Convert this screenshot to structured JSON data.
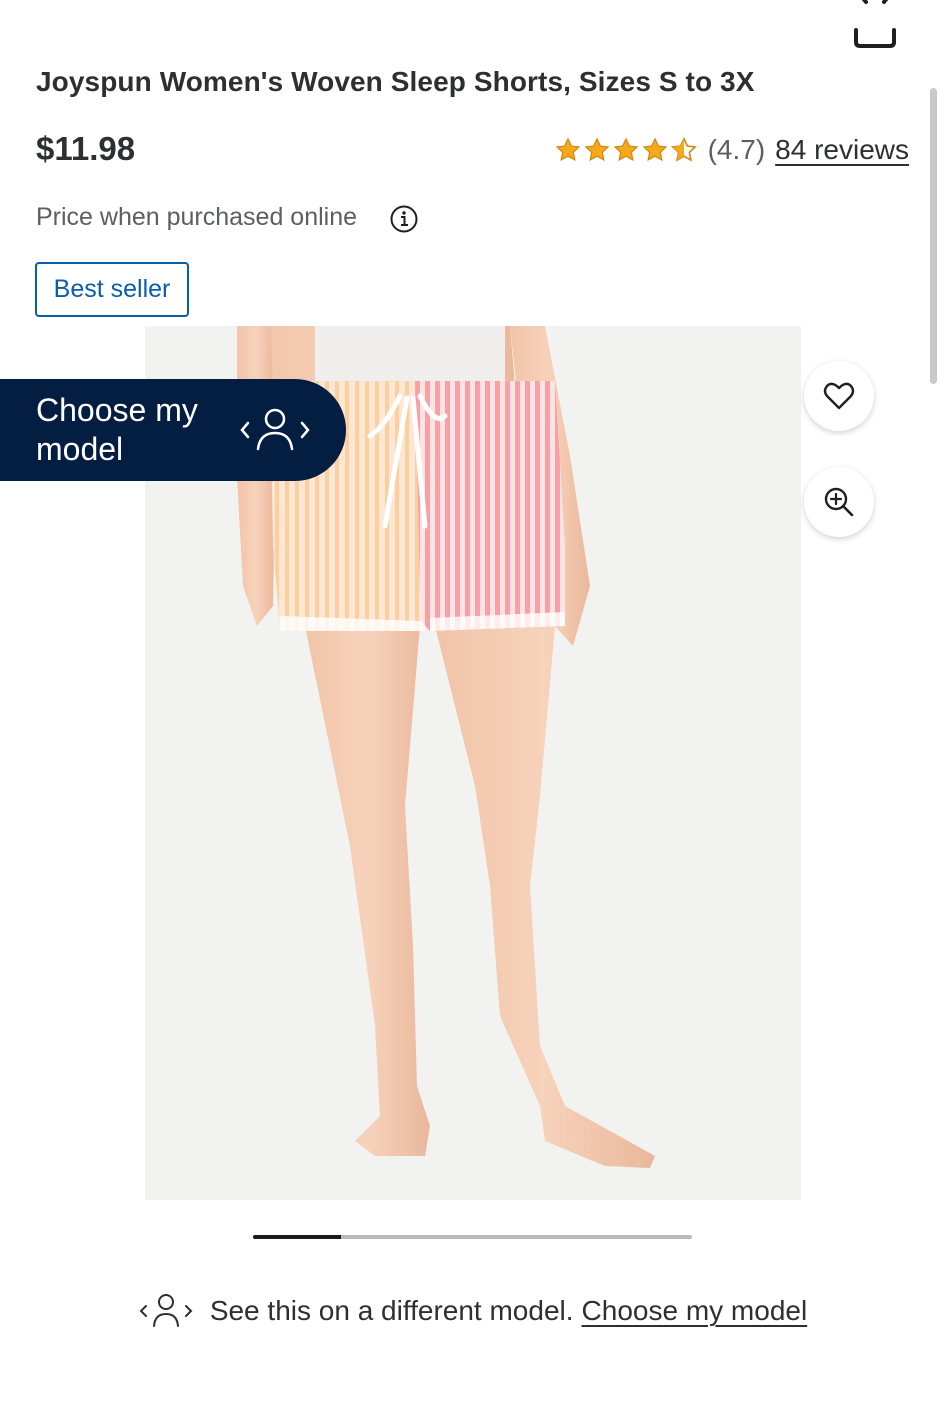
{
  "product": {
    "title": "Joyspun Women's Woven Sleep Shorts, Sizes S to 3X",
    "price": "$11.98",
    "price_note": "Price when purchased online",
    "badge": "Best seller",
    "rating": {
      "stars_value": 4.7,
      "value_text": "(4.7)",
      "reviews_text": "84 reviews"
    }
  },
  "gallery": {
    "choose_model_label": "Choose my model",
    "image_count_progress": 0.2,
    "colors": {
      "peach": "#fbd4b0",
      "pink": "#f7a8ab",
      "navy": "#041e42",
      "link_blue": "#0a5da8",
      "star_gold": "#f7a81b"
    }
  },
  "model_prompt": {
    "text": "See this on a different model.",
    "link": "Choose my model"
  },
  "icons": {
    "favorite": "heart-icon",
    "zoom": "zoom-in-icon",
    "info": "info-icon",
    "model": "person-swap-icon"
  }
}
